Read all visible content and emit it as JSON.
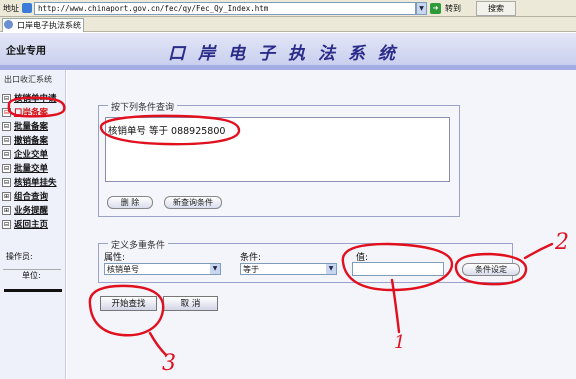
{
  "browser": {
    "address_label": "地址",
    "url": "http://www.chinaport.gov.cn/fec/qy/Fec_Qy_Index.htm",
    "go_label": "转到",
    "search_label": "搜索",
    "tab_title": "口岸电子执法系统"
  },
  "header": {
    "portal_label": "企业专用",
    "app_title": "口岸电子执法系统"
  },
  "sidebar": {
    "title": "出口收汇系统",
    "items": [
      {
        "label": "核销单申请",
        "expander": "⊟"
      },
      {
        "label": "口岸备案",
        "expander": "⊟"
      },
      {
        "label": "批量备案",
        "expander": "⊟"
      },
      {
        "label": "撤销备案",
        "expander": "⊟"
      },
      {
        "label": "企业交单",
        "expander": "⊟"
      },
      {
        "label": "批量交单",
        "expander": "⊟"
      },
      {
        "label": "核销单挂失",
        "expander": "⊟"
      },
      {
        "label": "组合查询",
        "expander": "⊞"
      },
      {
        "label": "业务提醒",
        "expander": "⊞"
      },
      {
        "label": "返回主页",
        "expander": "⊟"
      }
    ],
    "operator_label": "操作员:",
    "unit_label": "单位:"
  },
  "query": {
    "legend": "按下列条件查询",
    "condition_text": "核销单号  等于  088925800",
    "delete_label": "删 除",
    "new_query_label": "新查询条件"
  },
  "define": {
    "legend": "定义多重条件",
    "attr_label": "属性:",
    "cond_label": "条件:",
    "value_label": "值:",
    "attr_value": "核销单号",
    "cond_value": "等于",
    "value_input": "",
    "set_label": "条件设定"
  },
  "actions": {
    "start_label": "开始查找",
    "cancel_label": "取 消"
  },
  "annotations": {
    "color": "#e0101e",
    "label_1": "1",
    "label_2": "2",
    "label_3": "3"
  }
}
